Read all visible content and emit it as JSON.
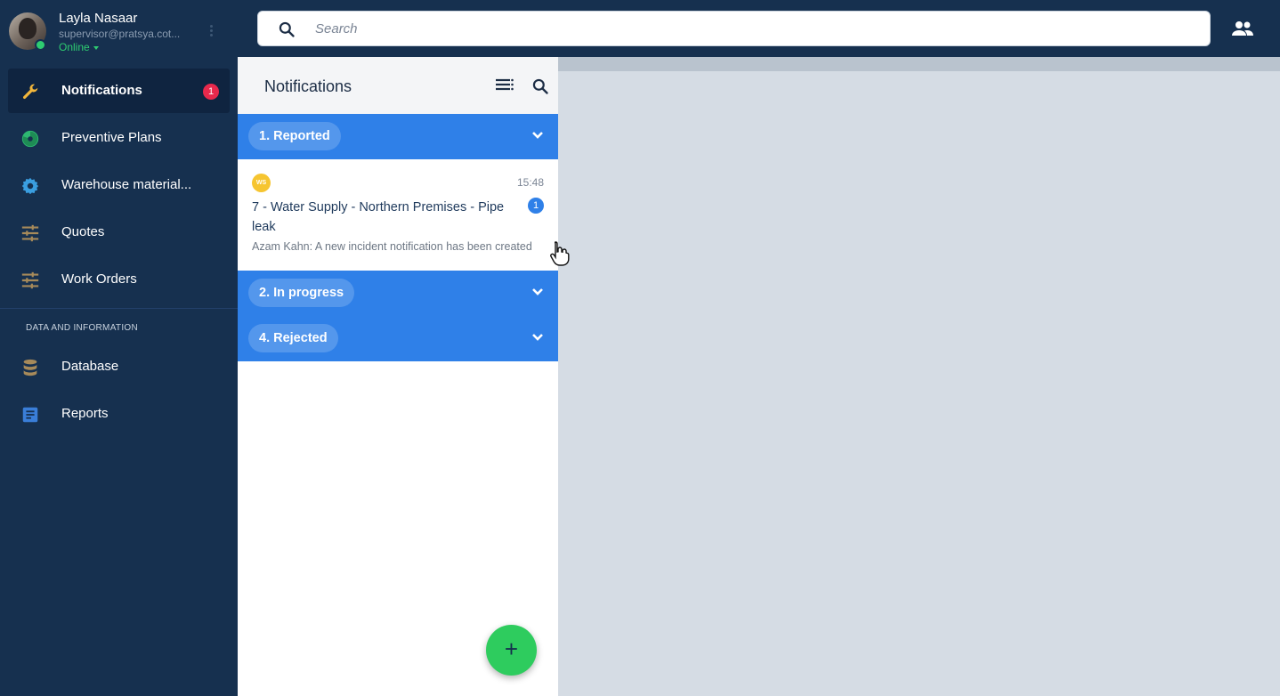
{
  "user": {
    "name": "Layla Nasaar",
    "email": "supervisor@pratsya.cot...",
    "status": "Online"
  },
  "search": {
    "placeholder": "Search"
  },
  "sidebar": {
    "items": [
      {
        "label": "Notifications",
        "icon": "wrench-icon",
        "badge": "1",
        "active": true
      },
      {
        "label": "Preventive Plans",
        "icon": "pie-chart-icon"
      },
      {
        "label": "Warehouse material...",
        "icon": "gear-icon"
      },
      {
        "label": "Quotes",
        "icon": "sliders-icon"
      },
      {
        "label": "Work Orders",
        "icon": "sliders-icon"
      }
    ],
    "section_label": "DATA AND INFORMATION",
    "data_items": [
      {
        "label": "Database",
        "icon": "database-icon"
      },
      {
        "label": "Reports",
        "icon": "document-icon"
      }
    ]
  },
  "panel": {
    "title": "Notifications",
    "groups": [
      {
        "label": "1. Reported"
      },
      {
        "label": "2. In progress"
      },
      {
        "label": "4. Rejected"
      }
    ],
    "notification": {
      "avatar_text": "WS",
      "time": "15:48",
      "title": "7 - Water Supply - Northern Premises - Pipe leak",
      "count": "1",
      "preview": "Azam Kahn: A new incident notification has been created"
    },
    "fab_label": "+"
  },
  "colors": {
    "nav_bg": "#16304f",
    "group_blue": "#2f80e8",
    "badge_red": "#e8294c",
    "online_green": "#2ecc71",
    "fab_green": "#2ecc5e",
    "avatar_yellow": "#f6c531"
  }
}
